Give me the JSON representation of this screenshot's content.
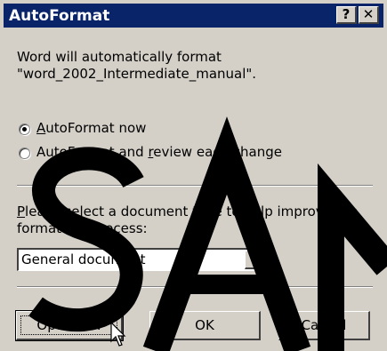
{
  "window": {
    "title": "AutoFormat",
    "help_label": "?",
    "close_label": "✕"
  },
  "message": {
    "line1": "Word will automatically format",
    "line2": "\"word_2002_Intermediate_manual\"."
  },
  "options": [
    {
      "label": "AutoFormat now",
      "selected": true
    },
    {
      "label": "AutoFormat and review each change",
      "selected": false
    }
  ],
  "doc_type": {
    "prompt_line1": "Please select a document type to help improve the",
    "prompt_line2": "formatting process:",
    "selected_value": "General document"
  },
  "buttons": {
    "options": "Options...",
    "ok": "OK",
    "cancel": "Cancel"
  },
  "watermark": {
    "text": "SAM",
    "color": "#000000"
  },
  "colors": {
    "titlebar": "#0a246a",
    "face": "#d4d0c8"
  }
}
